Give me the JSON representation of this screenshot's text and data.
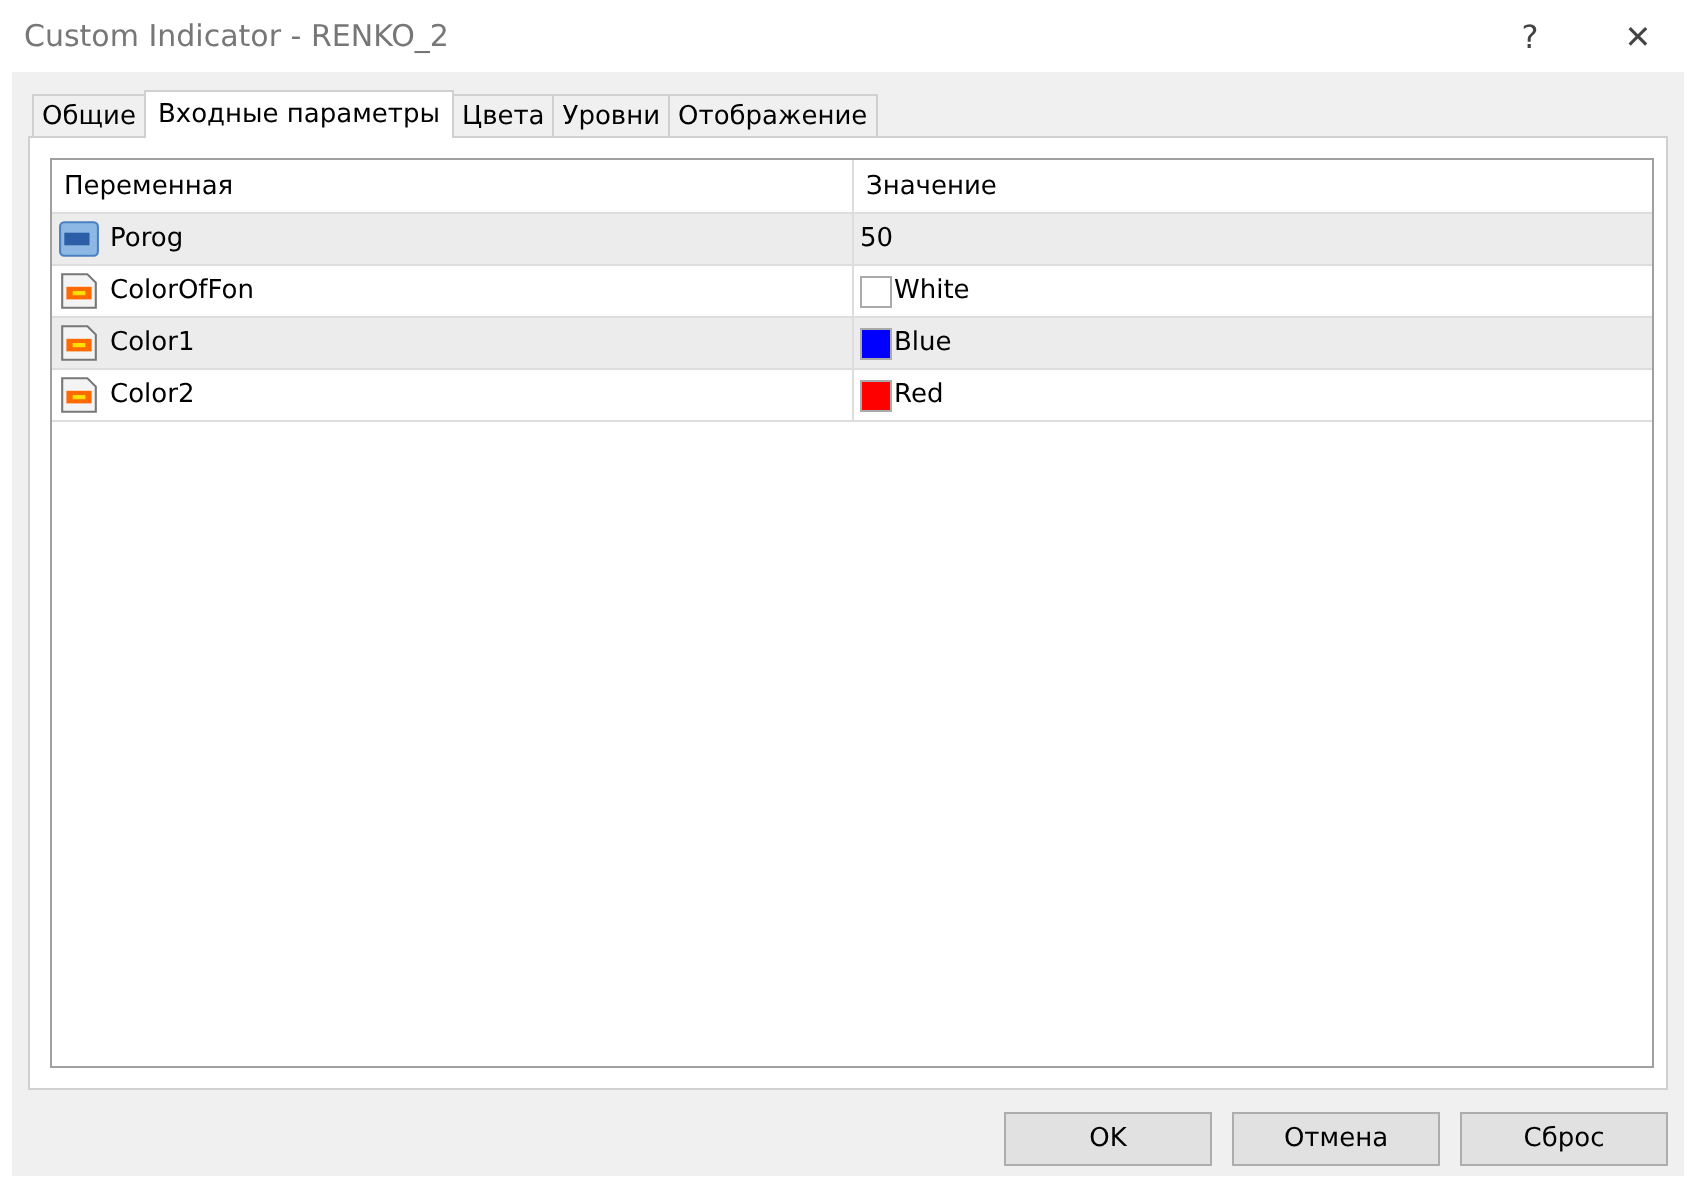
{
  "window": {
    "title": "Custom Indicator - RENKO_2",
    "help": "?",
    "close": "✕"
  },
  "tabs": [
    {
      "label": "Общие",
      "selected": false
    },
    {
      "label": "Входные параметры",
      "selected": true
    },
    {
      "label": "Цвета",
      "selected": false
    },
    {
      "label": "Уровни",
      "selected": false
    },
    {
      "label": "Отображение",
      "selected": false
    }
  ],
  "table": {
    "columns": [
      "Переменная",
      "Значение"
    ],
    "rows": [
      {
        "kind": "number",
        "name": "Porog",
        "value": "50"
      },
      {
        "kind": "color",
        "name": "ColorOfFon",
        "value": "White",
        "color": "#ffffff"
      },
      {
        "kind": "color",
        "name": "Color1",
        "value": "Blue",
        "color": "#0000ff"
      },
      {
        "kind": "color",
        "name": "Color2",
        "value": "Red",
        "color": "#ff0000"
      }
    ]
  },
  "buttons": [
    "OK",
    "Отмена",
    "Сброс"
  ]
}
